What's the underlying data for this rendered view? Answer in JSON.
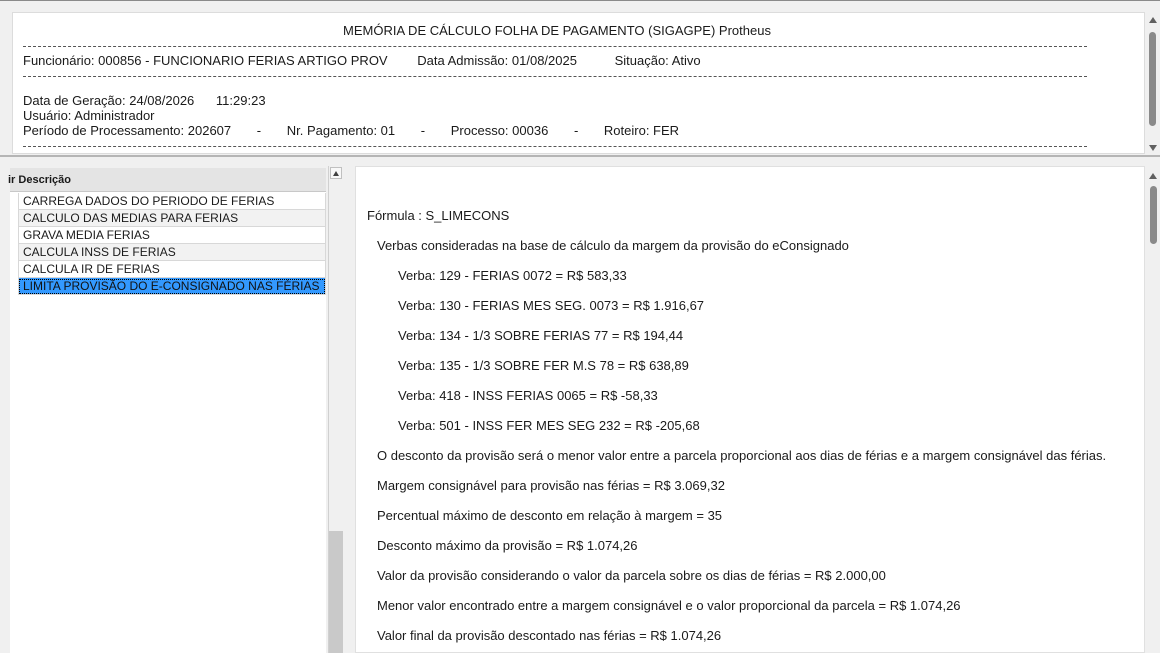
{
  "header": {
    "title": "MEMÓRIA DE CÁLCULO FOLHA DE PAGAMENTO (SIGAGPE) Protheus",
    "dashes": "--------------------------------------------------------------------------------------------------------------------------------------------------------------------------------------------------------------------------------------------------------------------------------",
    "funcionario": "Funcionário: 000856 - FUNCIONARIO FERIAS ARTIGO PROV",
    "data_admissao": "Data Admissão: 01/08/2025",
    "situacao": "Situação: Ativo",
    "data_geracao": "Data de Geração: 24/08/2026",
    "hora_geracao": "11:29:23",
    "usuario": "Usuário: Administrador",
    "periodo": "Período de Processamento: 202607",
    "sep": "-",
    "nr_pagamento": "Nr. Pagamento: 01",
    "processo": "Processo: 00036",
    "roteiro": "Roteiro: FER"
  },
  "list": {
    "column_header": "ir Descrição",
    "items": [
      "CARREGA DADOS DO PERIODO DE FERIAS",
      "CALCULO DAS MEDIAS PARA FERIAS",
      "GRAVA MEDIA FERIAS",
      "CALCULA INSS DE FERIAS",
      "CALCULA IR DE FERIAS",
      "LIMITA PROVISÃO DO E-CONSIGNADO NAS FÉRIAS"
    ],
    "selected_index": 5
  },
  "memo": {
    "formula": "Fórmula : S_LIMECONS",
    "verbas_intro": "Verbas consideradas na base de cálculo da margem da provisão do eConsignado",
    "verbas": [
      "Verba: 129 - FERIAS 0072 = R$ 583,33",
      "Verba: 130 - FERIAS MES SEG. 0073 = R$ 1.916,67",
      "Verba: 134 - 1/3 SOBRE FERIAS 77 = R$ 194,44",
      "Verba: 135 - 1/3 SOBRE FER M.S 78 = R$ 638,89",
      "Verba: 418 - INSS FERIAS 0065 = R$ -58,33",
      "Verba: 501 - INSS FER MES SEG 232 = R$ -205,68"
    ],
    "details": [
      "O desconto da provisão será o menor valor entre a parcela proporcional aos dias de férias e a margem consignável das férias.",
      "Margem consignável para provisão nas férias = R$ 3.069,32",
      "Percentual máximo de desconto em relação à margem = 35",
      "Desconto máximo da provisão = R$ 1.074,26",
      "Valor da provisão considerando o valor da parcela sobre os dias de férias = R$ 2.000,00",
      "Menor valor encontrado entre a margem consignável e o valor proporcional da parcela = R$ 1.074,26",
      "Valor final da provisão descontado nas férias = R$ 1.074,26"
    ]
  },
  "colors": {
    "selection": "#3399ff",
    "panel_bg": "#ffffff",
    "window_bg": "#f0f0f0",
    "scroll_thumb": "#8a8a8a"
  }
}
